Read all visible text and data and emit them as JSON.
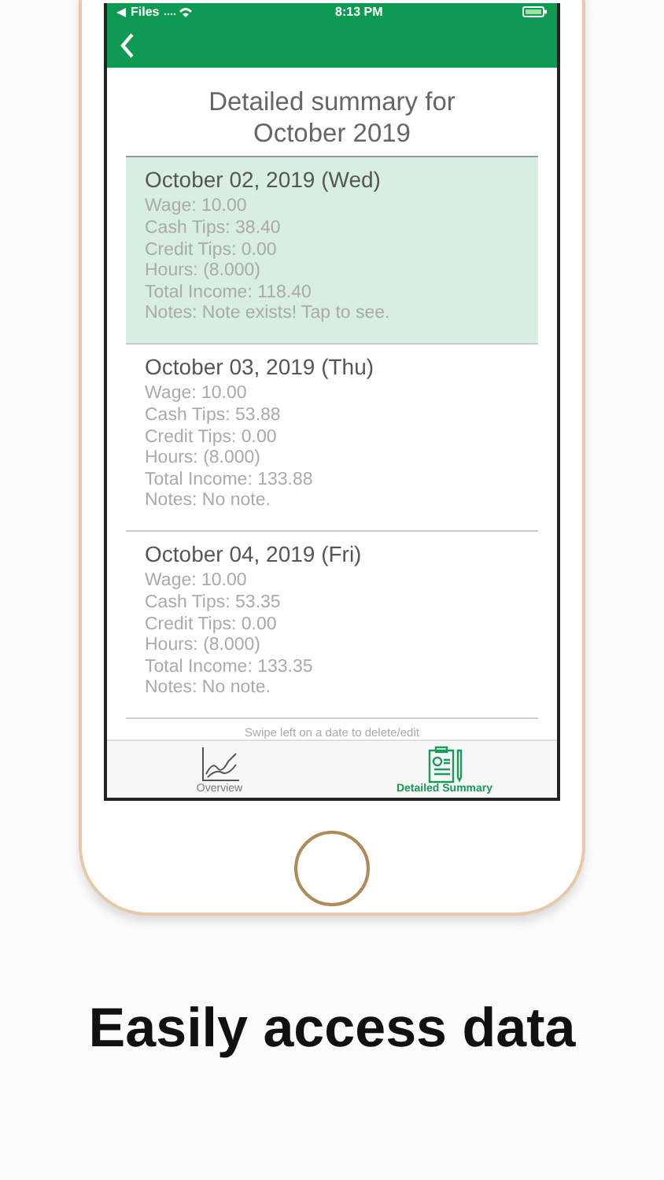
{
  "status_bar": {
    "back_label": "Files",
    "time": "8:13 PM"
  },
  "title_lines": [
    "Detailed summary for",
    "October 2019"
  ],
  "entries": [
    {
      "date": "October 02, 2019 (Wed)",
      "selected": true,
      "lines": [
        "Wage: 10.00",
        "Cash Tips: 38.40",
        "Credit Tips: 0.00",
        "Hours: (8.000)",
        "Total Income: 118.40",
        "Notes: Note exists! Tap to see."
      ]
    },
    {
      "date": "October 03, 2019 (Thu)",
      "selected": false,
      "lines": [
        "Wage: 10.00",
        "Cash Tips: 53.88",
        "Credit Tips: 0.00",
        "Hours: (8.000)",
        "Total Income: 133.88",
        "Notes: No note."
      ]
    },
    {
      "date": "October 04, 2019 (Fri)",
      "selected": false,
      "lines": [
        "Wage: 10.00",
        "Cash Tips: 53.35",
        "Credit Tips: 0.00",
        "Hours: (8.000)",
        "Total Income: 133.35",
        "Notes: No note."
      ]
    }
  ],
  "hint": "Swipe left on a date to delete/edit",
  "tabs": [
    {
      "kind": "chart",
      "label": "Overview",
      "selected": false
    },
    {
      "kind": "clipboard",
      "label": "Detailed Summary",
      "selected": true
    }
  ],
  "caption": "Easily access data"
}
